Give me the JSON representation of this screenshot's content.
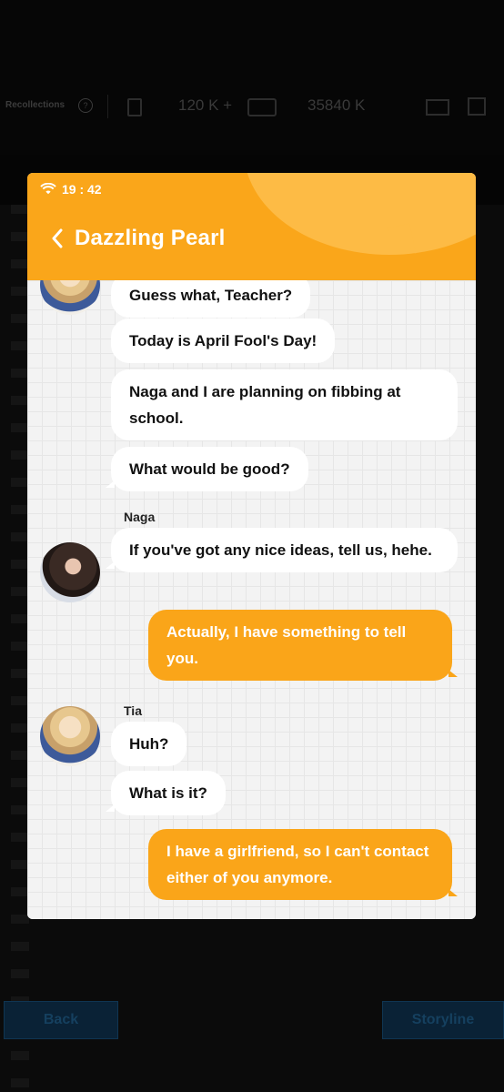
{
  "background": {
    "recollections_label": "Recollections",
    "resource_1": "120 K +",
    "resource_2": "35840 K",
    "back_button_label": "Back",
    "storyline_button_label": "Storyline"
  },
  "status_bar": {
    "time": "19 : 42"
  },
  "header": {
    "title": "Dazzling Pearl"
  },
  "messages": [
    {
      "sender": "",
      "side": "left",
      "text": "Guess what, Teacher?"
    },
    {
      "sender": "",
      "side": "left",
      "text": "Today is April Fool's Day!"
    },
    {
      "sender": "",
      "side": "left",
      "text": "Naga and I are planning on fibbing at school."
    },
    {
      "sender": "",
      "side": "left",
      "text": "What would be good?"
    },
    {
      "sender": "Naga",
      "side": "left",
      "text": "If you've got any nice ideas, tell us, hehe."
    },
    {
      "sender": "",
      "side": "right",
      "text": "Actually, I have something to tell you."
    },
    {
      "sender": "Tia",
      "side": "left",
      "text": "Huh?"
    },
    {
      "sender": "",
      "side": "left",
      "text": "What is it?"
    },
    {
      "sender": "",
      "side": "right",
      "text": "I have a girlfriend, so I can't contact either of you anymore."
    }
  ],
  "colors": {
    "header": "#faa61a",
    "player_bubble": "#faa519",
    "npc_bubble": "#ffffff"
  }
}
